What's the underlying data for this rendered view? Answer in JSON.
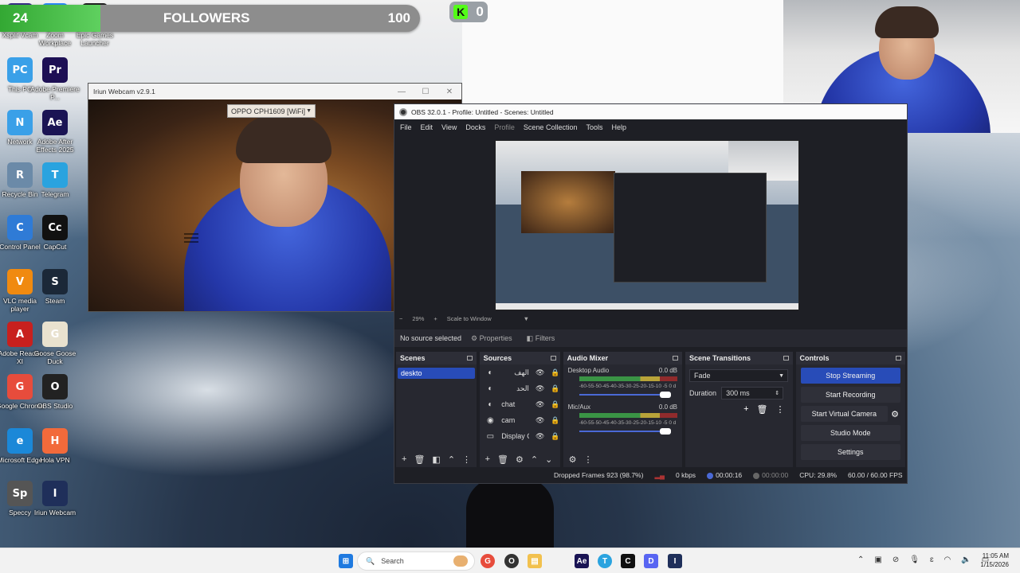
{
  "followers_bar": {
    "count": "24",
    "label": "FOLLOWERS",
    "goal": "100",
    "progress": 0.24
  },
  "kick_badge": {
    "count": "0"
  },
  "desktop_icons": [
    {
      "label": "Xsplit Vcam",
      "color": "#3a2f8a",
      "glyph": "X"
    },
    {
      "label": "Zoom Workplace",
      "color": "#2d8cff",
      "glyph": "Z"
    },
    {
      "label": "Epic Games Launcher",
      "color": "#222222",
      "glyph": "E"
    },
    {
      "label": "This PC",
      "color": "#3aa0e8",
      "glyph": "PC"
    },
    {
      "label": "Adobe Premiere P...",
      "color": "#1d0f54",
      "glyph": "Pr"
    },
    {
      "label": "Network",
      "color": "#3aa0e8",
      "glyph": "N"
    },
    {
      "label": "Adobe After Effects 2025",
      "color": "#1a1454",
      "glyph": "Ae"
    },
    {
      "label": "Recycle Bin",
      "color": "#6b8aa8",
      "glyph": "R"
    },
    {
      "label": "Telegram",
      "color": "#2aa3df",
      "glyph": "T"
    },
    {
      "label": "Control Panel",
      "color": "#2f7bd6",
      "glyph": "C"
    },
    {
      "label": "CapCut",
      "color": "#111111",
      "glyph": "Cc"
    },
    {
      "label": "VLC media player",
      "color": "#f08a10",
      "glyph": "V"
    },
    {
      "label": "Steam",
      "color": "#1b2838",
      "glyph": "S"
    },
    {
      "label": "Adobe Reader XI",
      "color": "#c8201e",
      "glyph": "A"
    },
    {
      "label": "Goose Goose Duck",
      "color": "#e9e2cf",
      "glyph": "G"
    },
    {
      "label": "Google Chrome",
      "color": "#e74c3c",
      "glyph": "G"
    },
    {
      "label": "OBS Studio",
      "color": "#222222",
      "glyph": "O"
    },
    {
      "label": "Microsoft Edge",
      "color": "#1b88d8",
      "glyph": "e"
    },
    {
      "label": "Hola VPN",
      "color": "#f26a3b",
      "glyph": "H"
    },
    {
      "label": "Speccy",
      "color": "#555555",
      "glyph": "Sp"
    },
    {
      "label": "Iriun Webcam",
      "color": "#1f2f5a",
      "glyph": "I"
    }
  ],
  "webcam_window": {
    "title": "Iriun Webcam v2.9.1",
    "device": "OPPO CPH1609 [WiFi]"
  },
  "obs": {
    "title": "OBS 32.0.1 - Profile: Untitled - Scenes: Untitled",
    "menu": [
      "File",
      "Edit",
      "View",
      "Docks",
      "Profile",
      "Scene Collection",
      "Tools",
      "Help"
    ],
    "zoom": "29%",
    "scale_mode": "Scale to Window",
    "no_source": "No source selected",
    "properties": "Properties",
    "filters": "Filters",
    "scenes": {
      "title": "Scenes",
      "items": [
        "deskto"
      ]
    },
    "sources": {
      "title": "Sources",
      "items": [
        "الهف",
        "الحد",
        "chat",
        "cam",
        "Display C"
      ]
    },
    "mixer": {
      "title": "Audio Mixer",
      "channels": [
        {
          "name": "Desktop Audio",
          "db": "0.0 dB"
        },
        {
          "name": "Mic/Aux",
          "db": "0.0 dB"
        }
      ],
      "scale": "-60-55-50-45-40-35-30-25-20-15-10 -5 0 d"
    },
    "transitions": {
      "title": "Scene Transitions",
      "type": "Fade",
      "duration_label": "Duration",
      "duration": "300 ms"
    },
    "controls": {
      "title": "Controls",
      "stop_streaming": "Stop Streaming",
      "start_recording": "Start Recording",
      "start_virtual_camera": "Start Virtual Camera",
      "studio_mode": "Studio Mode",
      "settings": "Settings"
    },
    "status": {
      "dropped": "Dropped Frames 923 (98.7%)",
      "kbps": "0 kbps",
      "stream_time": "00:00:16",
      "rec_time": "00:00:00",
      "cpu": "CPU: 29.8%",
      "fps": "60.00 / 60.00 FPS"
    }
  },
  "taskbar": {
    "search_placeholder": "Search",
    "time": "11:05 AM",
    "date": "1/15/2026"
  }
}
